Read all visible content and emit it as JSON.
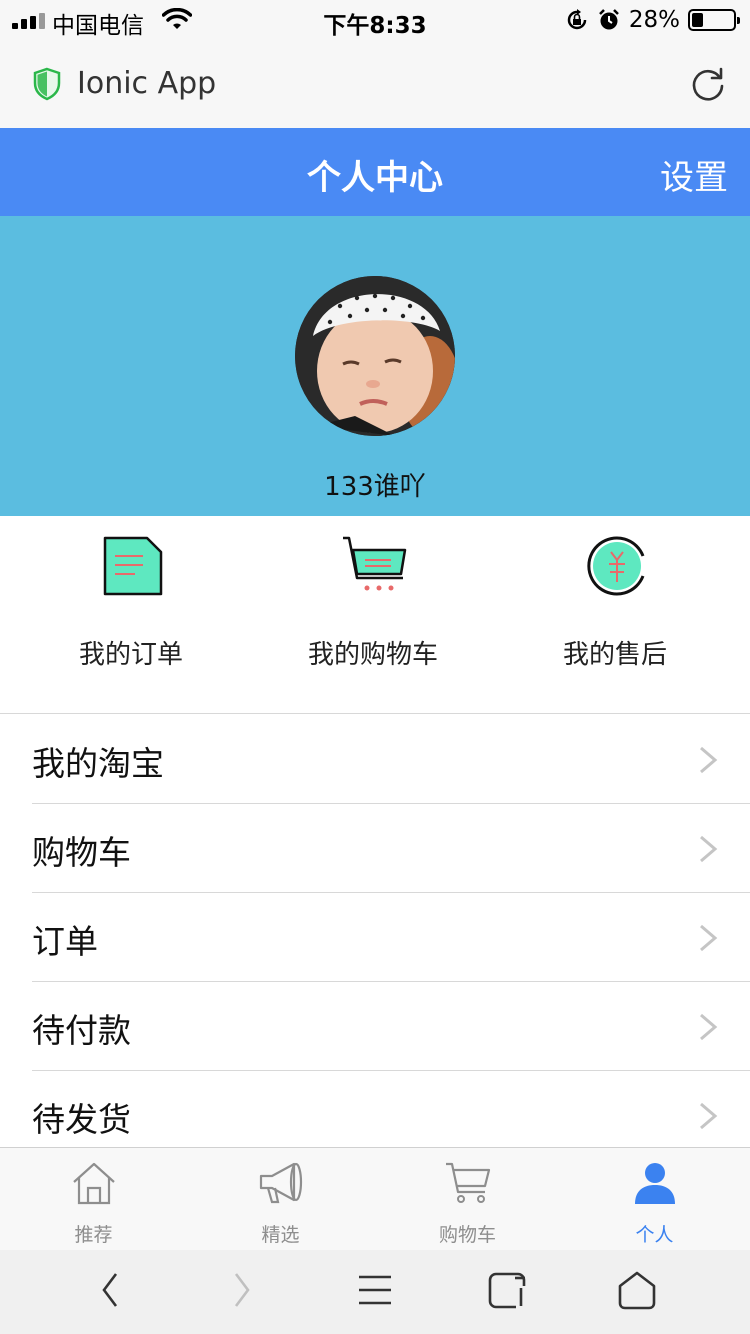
{
  "status_bar": {
    "carrier": "中国电信",
    "time": "下午8:33",
    "battery_text": "28%",
    "battery_level": 0.28,
    "icons": [
      "signal-icon",
      "wifi-icon",
      "orientation-lock-icon",
      "alarm-icon",
      "battery-icon"
    ]
  },
  "browser": {
    "title": "Ionic App",
    "icons": [
      "shield-icon",
      "reload-icon"
    ]
  },
  "navbar": {
    "title": "个人中心",
    "settings_label": "设置"
  },
  "profile": {
    "username": "133谁吖",
    "background_color": "#5bbde0"
  },
  "shortcuts": [
    {
      "label": "我的订单",
      "icon": "order-icon"
    },
    {
      "label": "我的购物车",
      "icon": "cart-icon"
    },
    {
      "label": "我的售后",
      "icon": "after-sales-icon"
    }
  ],
  "menu_items": [
    {
      "label": "我的淘宝"
    },
    {
      "label": "购物车"
    },
    {
      "label": "订单"
    },
    {
      "label": "待付款"
    },
    {
      "label": "待发货"
    }
  ],
  "tabs": [
    {
      "label": "推荐",
      "icon": "home-icon",
      "active": false
    },
    {
      "label": "精选",
      "icon": "megaphone-icon",
      "active": false
    },
    {
      "label": "购物车",
      "icon": "cart-icon",
      "active": false
    },
    {
      "label": "个人",
      "icon": "person-icon",
      "active": true
    }
  ],
  "colors": {
    "primary": "#4a8af4",
    "tab_active": "#3b82f0",
    "shortcut_fill": "#5ee8c0",
    "shortcut_accent": "#e86a6a"
  }
}
